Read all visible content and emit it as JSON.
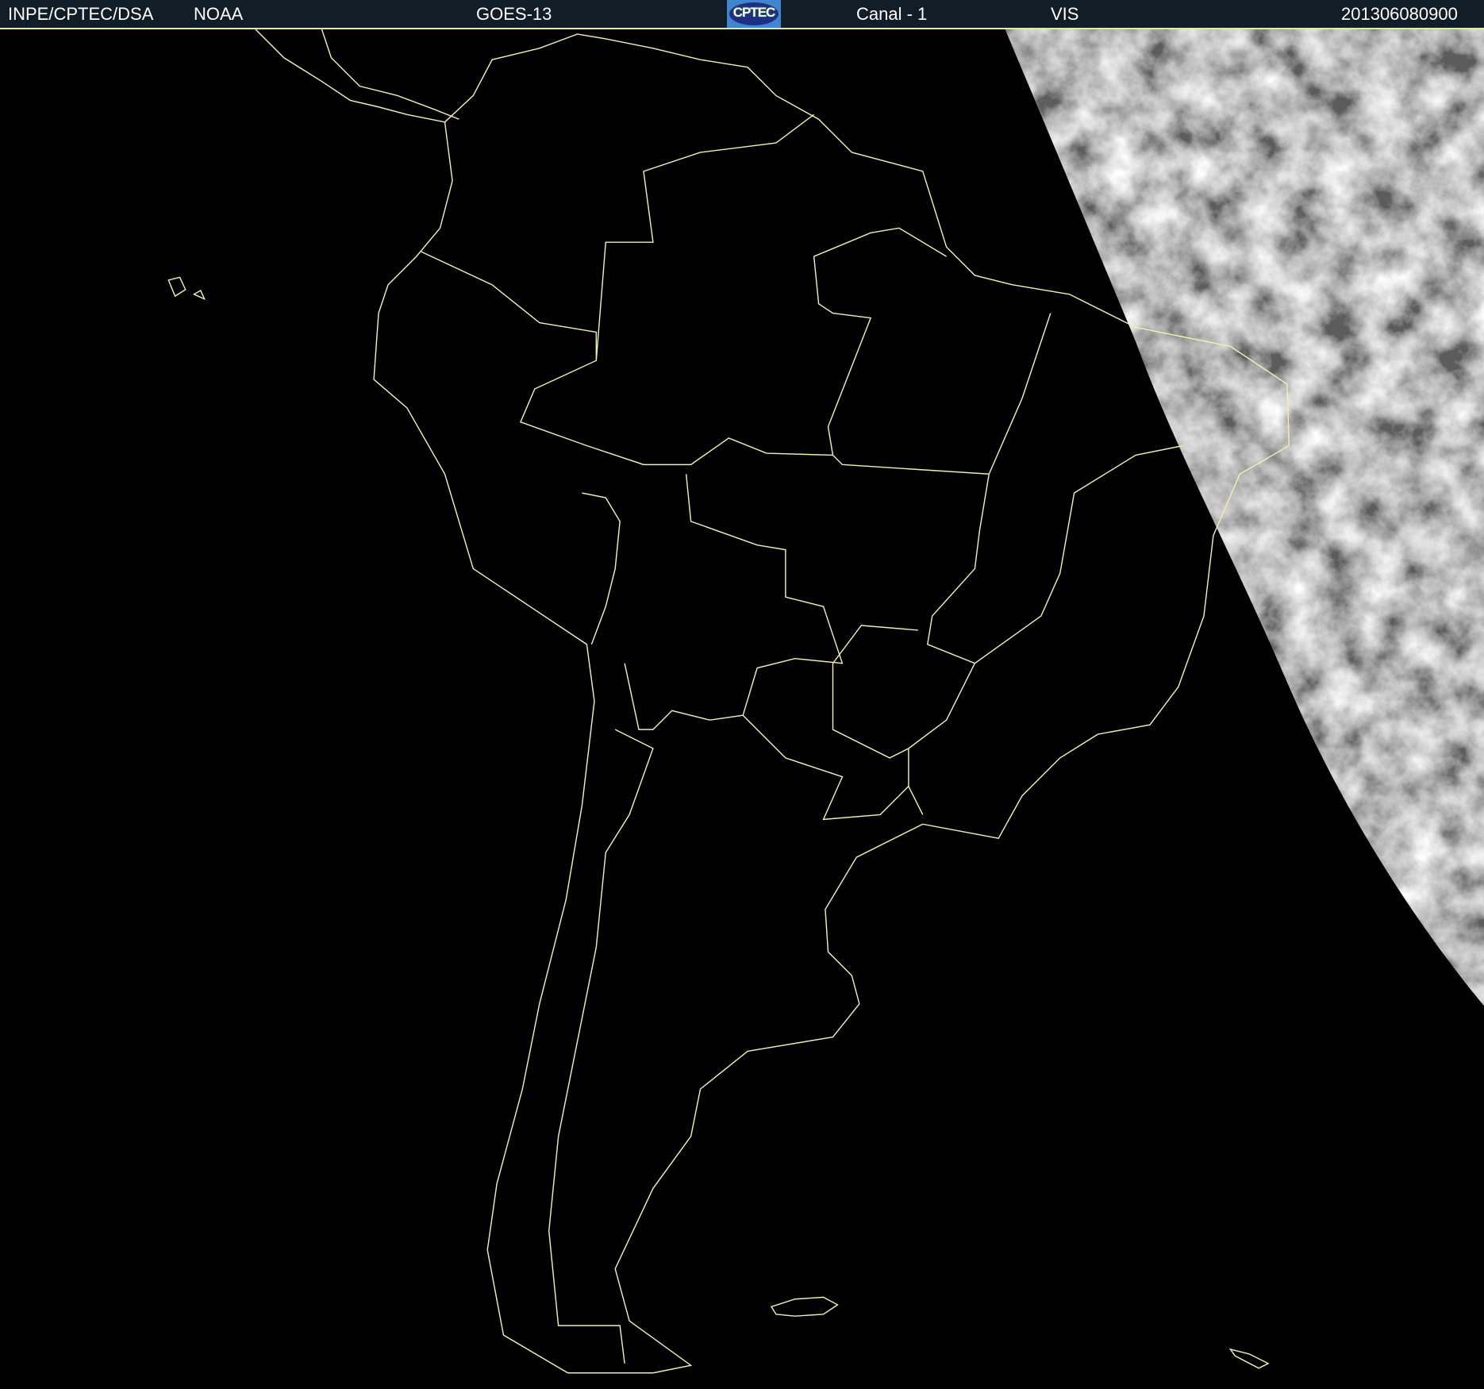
{
  "header": {
    "institution": "INPE/CPTEC/DSA",
    "agency": "NOAA",
    "satellite": "GOES-13",
    "logo_text": "CPTEC",
    "channel": "Canal - 1",
    "band": "VIS",
    "timestamp": "201306080900"
  },
  "colors": {
    "header_bg": "#111d27",
    "border_lines": "#f0f0b0",
    "background": "#000000"
  }
}
